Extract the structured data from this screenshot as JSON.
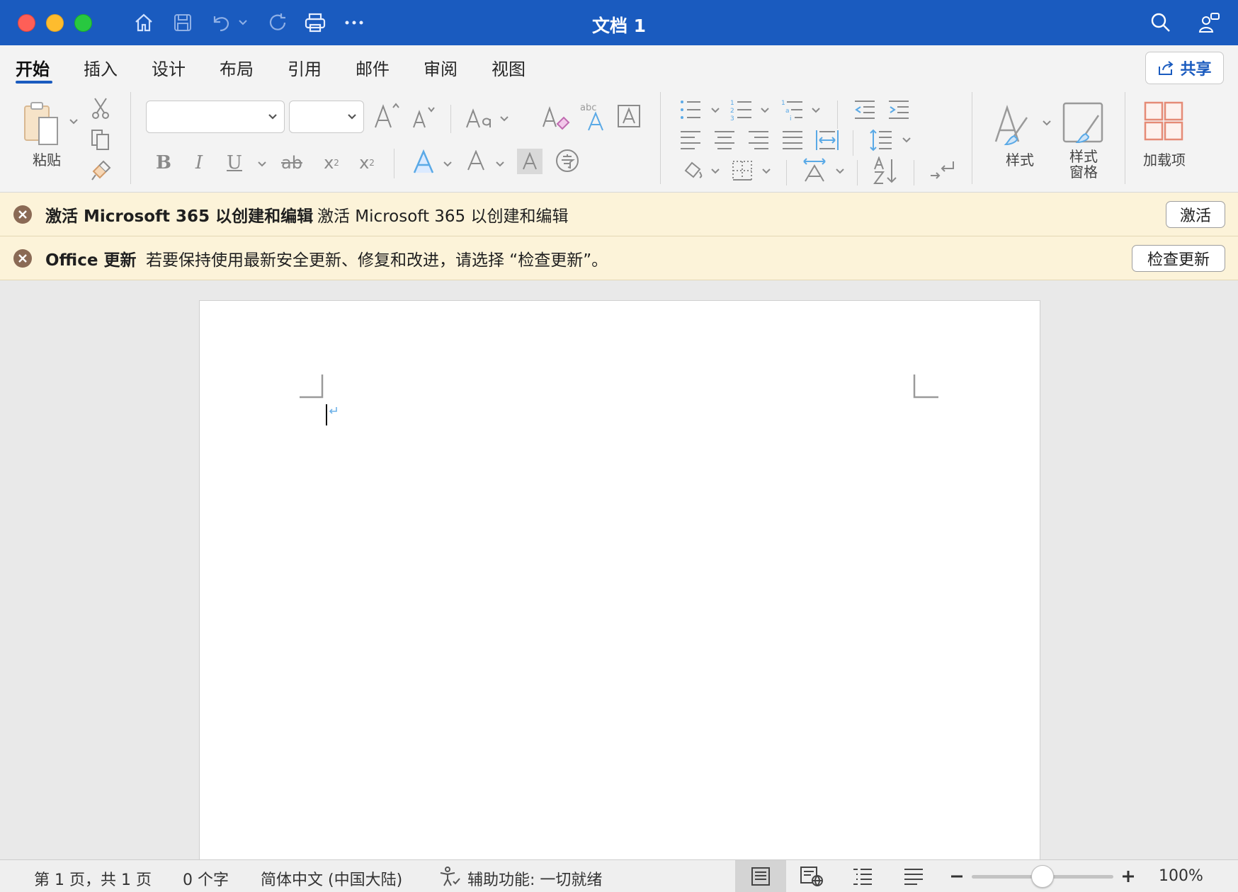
{
  "window": {
    "title": "文档 1"
  },
  "tabs": [
    "开始",
    "插入",
    "设计",
    "布局",
    "引用",
    "邮件",
    "审阅",
    "视图"
  ],
  "share_label": "共享",
  "ribbon": {
    "paste_label": "粘贴",
    "styles_label": "样式",
    "style_pane_label": "样式\n窗格",
    "addins_label": "加载项",
    "font_name": "",
    "font_size": ""
  },
  "notifications": [
    {
      "title": "激活 Microsoft 365 以创建和编辑",
      "message": "激活 Microsoft 365 以创建和编辑",
      "button": "激活"
    },
    {
      "title": "Office 更新",
      "message": "若要保持使用最新安全更新、修复和改进，请选择 “检查更新”。",
      "button": "检查更新"
    }
  ],
  "status": {
    "page": "第 1 页，共 1 页",
    "words": "0 个字",
    "language": "简体中文 (中国大陆)",
    "accessibility": "辅助功能: 一切就绪",
    "zoom": "100%",
    "zoom_level": 0.5
  },
  "colors": {
    "titlebar": "#1a5bbf",
    "accent": "#1a5bbf",
    "notification_bg": "#fcf3d9"
  }
}
